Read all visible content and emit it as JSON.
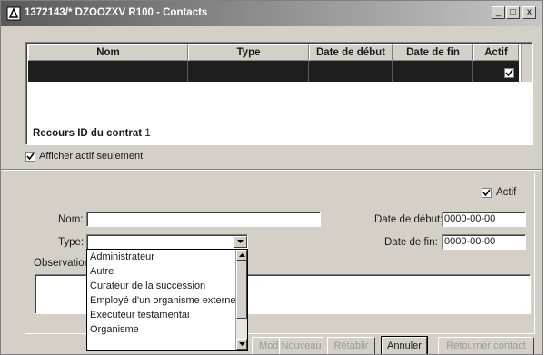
{
  "window": {
    "title": "1372143/* DZOOZXV R100  - Contacts",
    "minimize_label": "_",
    "restore_label": "□",
    "close_label": "x"
  },
  "grid": {
    "columns": [
      "Nom",
      "Type",
      "Date de début",
      "Date de fin",
      "Actif"
    ],
    "selected_row_actif": true,
    "recours_label": "Recours ID du contrat",
    "recours_value": "1"
  },
  "filter": {
    "label": "Afficher actif seulement",
    "checked": true
  },
  "form": {
    "actif_label": "Actif",
    "actif_checked": true,
    "nom_label": "Nom",
    "nom_value": "",
    "type_label": "Type",
    "type_value": "",
    "observation_label": "Observation",
    "date_debut_label": "Date de début",
    "date_debut_value": "0000-00-00",
    "date_fin_label": "Date de fin",
    "date_fin_value": "0000-00-00"
  },
  "type_dropdown": {
    "options": [
      "Administrateur",
      "Autre",
      "Curateur de la succession",
      "Employé d'un organisme externe",
      "Exécuteur testamentai",
      "Organisme"
    ]
  },
  "buttons": {
    "modifier": "Modifier",
    "nouveau": "Nouveau",
    "retablir": "Rétablir",
    "annuler": "Annuler",
    "retourner": "Retourner contact"
  }
}
